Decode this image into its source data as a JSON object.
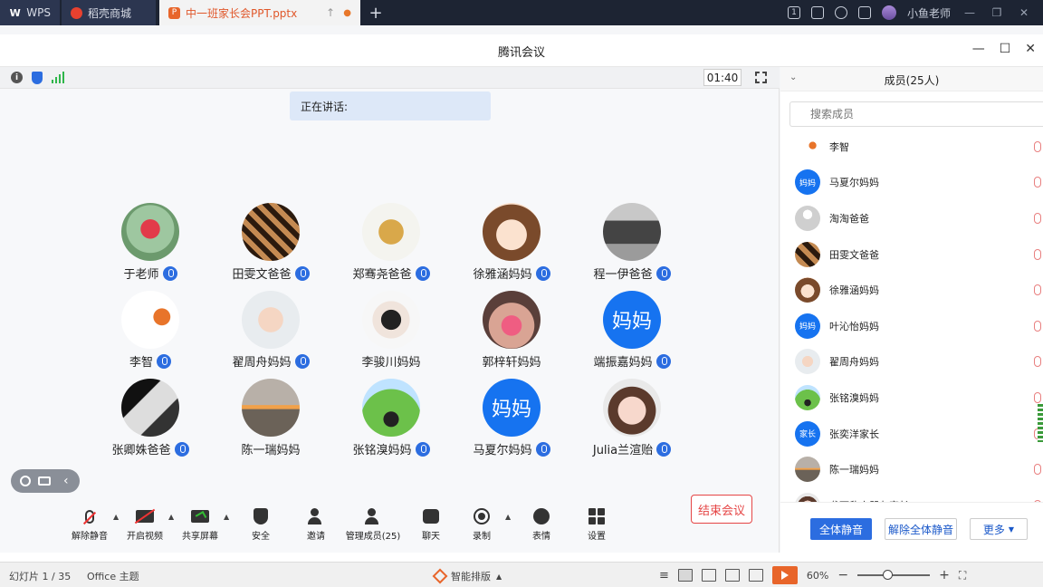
{
  "tabbar": {
    "tabs": [
      {
        "label": "WPS"
      },
      {
        "label": "稻壳商城"
      },
      {
        "label": "中一班家长会PPT.pptx"
      }
    ],
    "user_name": "小鱼老师",
    "badge": "1"
  },
  "meeting": {
    "title": "腾讯会议",
    "timer": "01:40",
    "speaking_label": "正在讲话:",
    "participants": [
      {
        "name": "于老师",
        "mic": true,
        "avatar": "robot-toy-photo"
      },
      {
        "name": "田雯文爸爸",
        "mic": true,
        "avatar": "brand-logo-photo"
      },
      {
        "name": "郑骞尧爸爸",
        "mic": true,
        "avatar": "clover-logo"
      },
      {
        "name": "徐雅涵妈妈",
        "mic": true,
        "avatar": "cartoon-girl"
      },
      {
        "name": "程一伊爸爸",
        "mic": true,
        "avatar": "shop-photo"
      },
      {
        "name": "李智",
        "mic": true,
        "avatar": "basketball-cartoon"
      },
      {
        "name": "翟周舟妈妈",
        "mic": true,
        "avatar": "baby-photo"
      },
      {
        "name": "李骏川妈妈",
        "mic": false,
        "avatar": "boy-mask-photo"
      },
      {
        "name": "郭梓轩妈妈",
        "mic": false,
        "avatar": "girl-pink-photo"
      },
      {
        "name": "端振嘉妈妈",
        "mic": true,
        "avatar_text": "妈妈",
        "color": "#1673f0"
      },
      {
        "name": "张卿姝爸爸",
        "mic": true,
        "avatar": "fist-photo"
      },
      {
        "name": "陈一瑞妈妈",
        "mic": false,
        "avatar": "sunset-photo"
      },
      {
        "name": "张铭溴妈妈",
        "mic": true,
        "avatar": "forest-cartoon"
      },
      {
        "name": "马夏尔妈妈",
        "mic": true,
        "avatar_text": "妈妈",
        "color": "#1673f0"
      },
      {
        "name": "Julia兰渲贻",
        "mic": true,
        "avatar": "little-girl-photo"
      }
    ],
    "toolbar": [
      {
        "label": "解除静音",
        "icon": "mic-off-icon"
      },
      {
        "label": "开启视频",
        "icon": "camera-off-icon"
      },
      {
        "label": "共享屏幕",
        "icon": "share-screen-icon"
      },
      {
        "label": "安全",
        "icon": "shield-icon"
      },
      {
        "label": "邀请",
        "icon": "invite-icon"
      },
      {
        "label": "管理成员(25)",
        "icon": "members-icon"
      },
      {
        "label": "聊天",
        "icon": "chat-icon"
      },
      {
        "label": "录制",
        "icon": "record-icon"
      },
      {
        "label": "表情",
        "icon": "emoji-icon"
      },
      {
        "label": "设置",
        "icon": "settings-icon"
      }
    ],
    "end_meeting": "结束会议"
  },
  "members": {
    "title": "成员(25人)",
    "search_placeholder": "搜索成员",
    "list": [
      {
        "name": "李智",
        "avatar": "basketball-cartoon"
      },
      {
        "name": "马夏尔妈妈",
        "avatar_text": "妈妈",
        "color": "#1673f0"
      },
      {
        "name": "淘淘爸爸",
        "avatar": "default-gray"
      },
      {
        "name": "田雯文爸爸",
        "avatar": "brand-logo-photo"
      },
      {
        "name": "徐雅涵妈妈",
        "avatar": "cartoon-girl"
      },
      {
        "name": "叶沁怡妈妈",
        "avatar_text": "妈妈",
        "color": "#1673f0"
      },
      {
        "name": "翟周舟妈妈",
        "avatar": "baby-photo"
      },
      {
        "name": "张铭溴妈妈",
        "avatar": "forest-cartoon"
      },
      {
        "name": "张奕洋家长",
        "avatar_text": "家长",
        "color": "#1673f0"
      },
      {
        "name": "陈一瑞妈妈",
        "avatar": "sunset-photo"
      },
      {
        "name": "龚可欣小朋友家长",
        "avatar": "little-girl-photo"
      }
    ],
    "mute_all": "全体静音",
    "unmute_all": "解除全体静音",
    "more": "更多"
  },
  "statusbar": {
    "slide_info": "幻灯片 1 / 35",
    "theme": "Office 主题",
    "smart_layout": "智能排版",
    "zoom": "60%"
  },
  "colors": {
    "accent": "#2c6de0",
    "danger": "#e54545",
    "wps_orange": "#e8652a"
  }
}
